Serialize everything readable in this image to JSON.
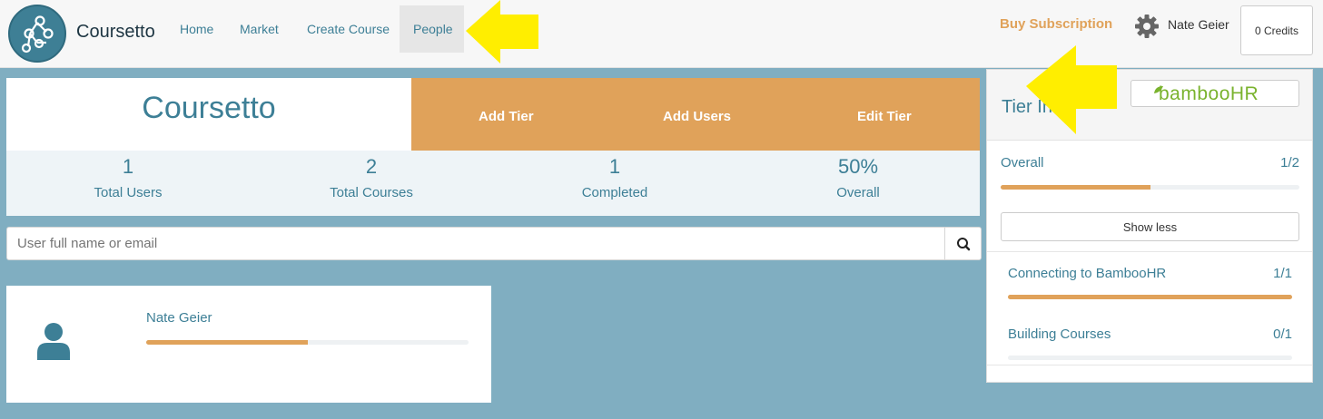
{
  "nav": {
    "brand": "Coursetto",
    "items": [
      {
        "label": "Home"
      },
      {
        "label": "Market"
      },
      {
        "label": "Create Course"
      },
      {
        "label": "People"
      }
    ],
    "buy_subscription": "Buy Subscription",
    "user_name": "Nate Geier",
    "credits": "0 Credits"
  },
  "header": {
    "title": "Coursetto",
    "actions": [
      "Add Tier",
      "Add Users",
      "Edit Tier"
    ]
  },
  "stats": [
    {
      "value": "1",
      "label": "Total Users"
    },
    {
      "value": "2",
      "label": "Total Courses"
    },
    {
      "value": "1",
      "label": "Completed"
    },
    {
      "value": "50%",
      "label": "Overall"
    }
  ],
  "search": {
    "placeholder": "User full name or email"
  },
  "user_card": {
    "name": "Nate Geier",
    "progress": 0.5
  },
  "tier_info": {
    "title": "Tier Info",
    "brand_logo": "bambooHR",
    "overall": {
      "label": "Overall",
      "count": "1/2",
      "progress": 0.5
    },
    "show_less": "Show less",
    "courses": [
      {
        "label": "Connecting to BambooHR",
        "count": "1/1",
        "progress": 1.0
      },
      {
        "label": "Building Courses",
        "count": "0/1",
        "progress": 0.0
      }
    ]
  },
  "colors": {
    "accent_teal": "#3d7f96",
    "accent_orange": "#e0a25a",
    "page_background": "#80aec1",
    "annotation_arrow": "#ffee00"
  }
}
